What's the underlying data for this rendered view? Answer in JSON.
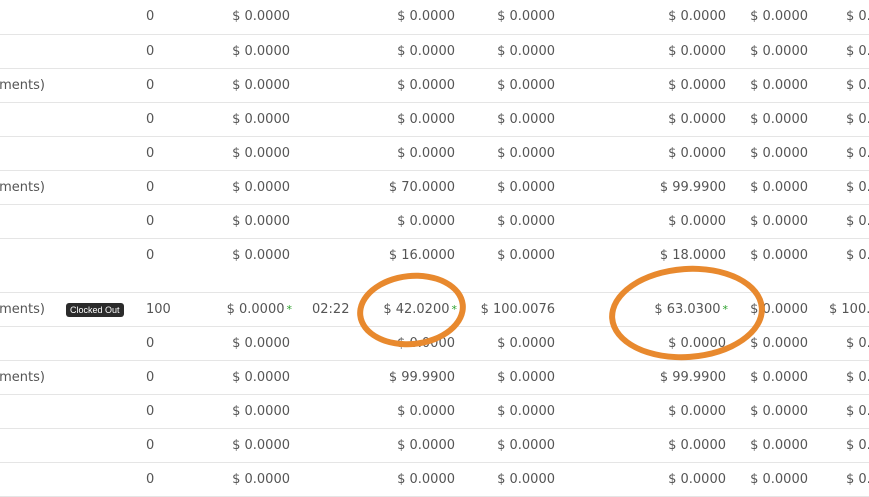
{
  "rows": [
    {
      "name": "",
      "badge": "",
      "qty": "0",
      "c1": "$ 0.0000",
      "c1_star": "",
      "time": "",
      "c2": "$ 0.0000",
      "c2_star": "",
      "c3": "$ 0.0000",
      "c4": "$ 0.0000",
      "c4_star": "",
      "c5": "$ 0.0000",
      "c6": "$ 0."
    },
    {
      "name": "",
      "badge": "",
      "qty": "0",
      "c1": "$ 0.0000",
      "c1_star": "",
      "time": "",
      "c2": "$ 0.0000",
      "c2_star": "",
      "c3": "$ 0.0000",
      "c4": "$ 0.0000",
      "c4_star": "",
      "c5": "$ 0.0000",
      "c6": "$ 0."
    },
    {
      "name": "tments)",
      "badge": "",
      "qty": "0",
      "c1": "$ 0.0000",
      "c1_star": "",
      "time": "",
      "c2": "$ 0.0000",
      "c2_star": "",
      "c3": "$ 0.0000",
      "c4": "$ 0.0000",
      "c4_star": "",
      "c5": "$ 0.0000",
      "c6": "$ 0."
    },
    {
      "name": "",
      "badge": "",
      "qty": "0",
      "c1": "$ 0.0000",
      "c1_star": "",
      "time": "",
      "c2": "$ 0.0000",
      "c2_star": "",
      "c3": "$ 0.0000",
      "c4": "$ 0.0000",
      "c4_star": "",
      "c5": "$ 0.0000",
      "c6": "$ 0."
    },
    {
      "name": "",
      "badge": "",
      "qty": "0",
      "c1": "$ 0.0000",
      "c1_star": "",
      "time": "",
      "c2": "$ 0.0000",
      "c2_star": "",
      "c3": "$ 0.0000",
      "c4": "$ 0.0000",
      "c4_star": "",
      "c5": "$ 0.0000",
      "c6": "$ 0."
    },
    {
      "name": "tments)",
      "badge": "",
      "qty": "0",
      "c1": "$ 0.0000",
      "c1_star": "",
      "time": "",
      "c2": "$ 70.0000",
      "c2_star": "",
      "c3": "$ 0.0000",
      "c4": "$ 99.9900",
      "c4_star": "",
      "c5": "$ 0.0000",
      "c6": "$ 0."
    },
    {
      "name": "",
      "badge": "",
      "qty": "0",
      "c1": "$ 0.0000",
      "c1_star": "",
      "time": "",
      "c2": "$ 0.0000",
      "c2_star": "",
      "c3": "$ 0.0000",
      "c4": "$ 0.0000",
      "c4_star": "",
      "c5": "$ 0.0000",
      "c6": "$ 0."
    },
    {
      "name": "",
      "badge": "",
      "qty": "0",
      "c1": "$ 0.0000",
      "c1_star": "",
      "time": "",
      "c2": "$ 16.0000",
      "c2_star": "",
      "c3": "$ 0.0000",
      "c4": "$ 18.0000",
      "c4_star": "",
      "c5": "$ 0.0000",
      "c6": "$ 0."
    },
    {
      "name": "tments)",
      "badge": "Clocked Out",
      "qty": "100",
      "c1": "$ 0.0000",
      "c1_star": "*",
      "time": "02:22",
      "c2": "$ 42.0200",
      "c2_star": "*",
      "c3": "$ 100.0076",
      "c4": "$ 63.0300",
      "c4_star": "*",
      "c5": "$ 0.0000",
      "c6": "$ 100."
    },
    {
      "name": "",
      "badge": "",
      "qty": "0",
      "c1": "$ 0.0000",
      "c1_star": "",
      "time": "",
      "c2": "$ 0.0000",
      "c2_star": "",
      "c3": "$ 0.0000",
      "c4": "$ 0.0000",
      "c4_star": "",
      "c5": "$ 0.0000",
      "c6": "$ 0."
    },
    {
      "name": "tments)",
      "badge": "",
      "qty": "0",
      "c1": "$ 0.0000",
      "c1_star": "",
      "time": "",
      "c2": "$ 99.9900",
      "c2_star": "",
      "c3": "$ 0.0000",
      "c4": "$ 99.9900",
      "c4_star": "",
      "c5": "$ 0.0000",
      "c6": "$ 0."
    },
    {
      "name": "",
      "badge": "",
      "qty": "0",
      "c1": "$ 0.0000",
      "c1_star": "",
      "time": "",
      "c2": "$ 0.0000",
      "c2_star": "",
      "c3": "$ 0.0000",
      "c4": "$ 0.0000",
      "c4_star": "",
      "c5": "$ 0.0000",
      "c6": "$ 0."
    },
    {
      "name": "",
      "badge": "",
      "qty": "0",
      "c1": "$ 0.0000",
      "c1_star": "",
      "time": "",
      "c2": "$ 0.0000",
      "c2_star": "",
      "c3": "$ 0.0000",
      "c4": "$ 0.0000",
      "c4_star": "",
      "c5": "$ 0.0000",
      "c6": "$ 0."
    },
    {
      "name": "",
      "badge": "",
      "qty": "0",
      "c1": "$ 0.0000",
      "c1_star": "",
      "time": "",
      "c2": "$ 0.0000",
      "c2_star": "",
      "c3": "$ 0.0000",
      "c4": "$ 0.0000",
      "c4_star": "",
      "c5": "$ 0.0000",
      "c6": "$ 0."
    }
  ],
  "colors": {
    "highlight": "#e8892e",
    "badge_bg": "#2b2b2b",
    "star": "#2ca02c",
    "divider": "#e5e5e5"
  }
}
